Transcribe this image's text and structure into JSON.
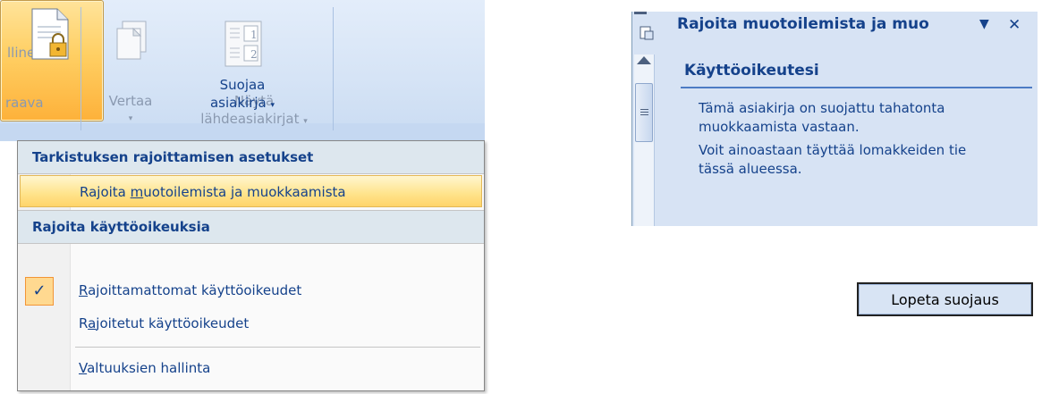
{
  "ribbon": {
    "partial_label_top": "llinen",
    "partial_label_bottom": "raava",
    "compare": {
      "line1": "Vertaa",
      "arrow": "▾"
    },
    "show_source": {
      "line1": "Näytä",
      "line2": "lähdeasiakirjat",
      "arrow": "▾"
    },
    "protect": {
      "line1": "Suojaa",
      "line2": "asiakirja",
      "arrow": "▾"
    },
    "page_numbers": [
      "1",
      "2"
    ]
  },
  "menu": {
    "header1": "Tarkistuksen rajoittamisen asetukset",
    "item_restrict_pre": "Rajoita ",
    "item_restrict_key": "m",
    "item_restrict_post": "uotoilemista ja muokkaamista",
    "header2": "Rajoita käyttöoikeuksia",
    "item_unrestricted_key": "R",
    "item_unrestricted_post": "ajoittamattomat käyttöoikeudet",
    "item_restricted_pre": "R",
    "item_restricted_key": "a",
    "item_restricted_post": "joitetut käyttöoikeudet",
    "item_manage_key": "V",
    "item_manage_post": "altuuksien hallinta",
    "checkmark": "✓"
  },
  "pane": {
    "title": "Rajoita muotoilemista ja muo",
    "dropdown_glyph": "▼",
    "close_glyph": "✕",
    "section_heading": "Käyttöoikeutesi",
    "text1_line1": "Tämä asiakirja on suojattu tahatonta",
    "text1_line2": "muokkaamista vastaan.",
    "text2_line1": "Voit ainoastaan täyttää lomakkeiden tie",
    "text2_line2": "tässä alueessa."
  },
  "stop_protection_label": "Lopeta suojaus",
  "colors": {
    "accent": "#15428b",
    "highlight": "#ffe38a",
    "pane_bg": "#d7e3f4"
  }
}
